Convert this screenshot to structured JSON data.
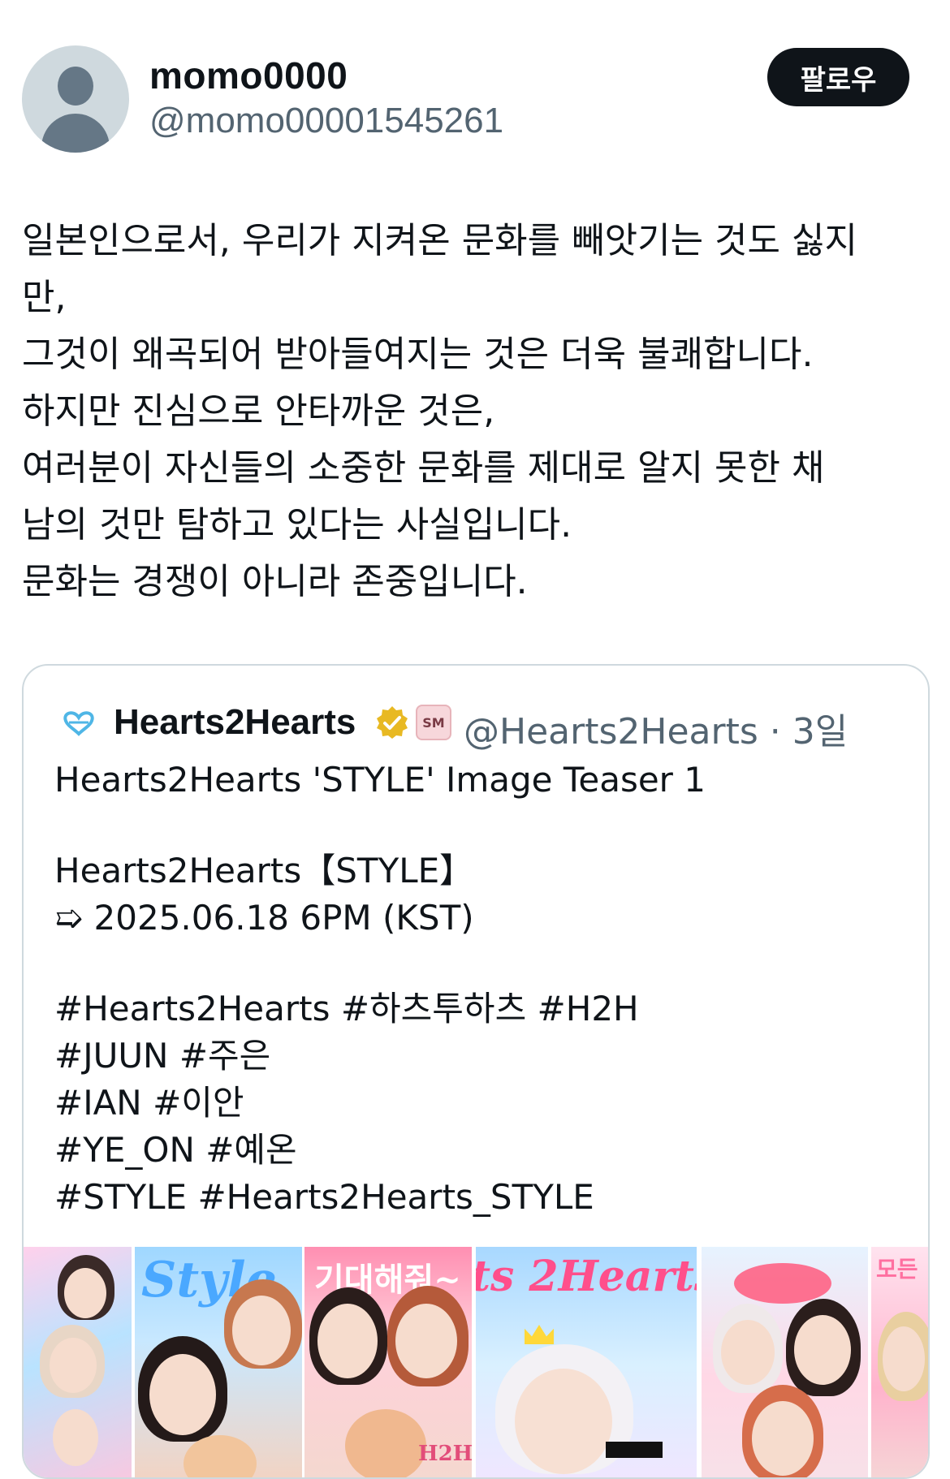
{
  "author": {
    "display_name": "momo0000",
    "handle": "@momo00001545261",
    "follow_label": "팔로우",
    "avatar_icon": "default-avatar-icon"
  },
  "tweet": {
    "lines": [
      "일본인으로서, 우리가 지켜온 문화를 빼앗기는 것도 싫지",
      "만,",
      "그것이 왜곡되어 받아들여지는 것은 더욱 불쾌합니다.",
      "하지만 진심으로 안타까운 것은,",
      "여러분이 자신들의 소중한 문화를 제대로 알지 못한 채",
      "남의 것만 탐하고 있다는 사실입니다.",
      "문화는 경쟁이 아니라 존중입니다."
    ]
  },
  "quoted": {
    "name": "Hearts2Hearts",
    "badge_text": "SM",
    "meta": "@Hearts2Hearts · 3일",
    "verified_color": "#e8b923",
    "lines": [
      "Hearts2Hearts 'STYLE' Image Teaser 1",
      "",
      "Hearts2Hearts【STYLE】",
      "➯ 2025.06.18 6PM (KST)",
      "",
      "#Hearts2Hearts #하츠투하츠 #H2H",
      "#JUUN #주은",
      "#IAN #이안",
      "#YE_ON #예온",
      "#STYLE #Hearts2Hearts_STYLE"
    ],
    "media_text": {
      "style_word": "Style",
      "korean_word": "기대해줘~",
      "hearts_word": "ts 2Hearts",
      "h2h_stamp": "H2H",
      "edge_word": "모든"
    }
  }
}
